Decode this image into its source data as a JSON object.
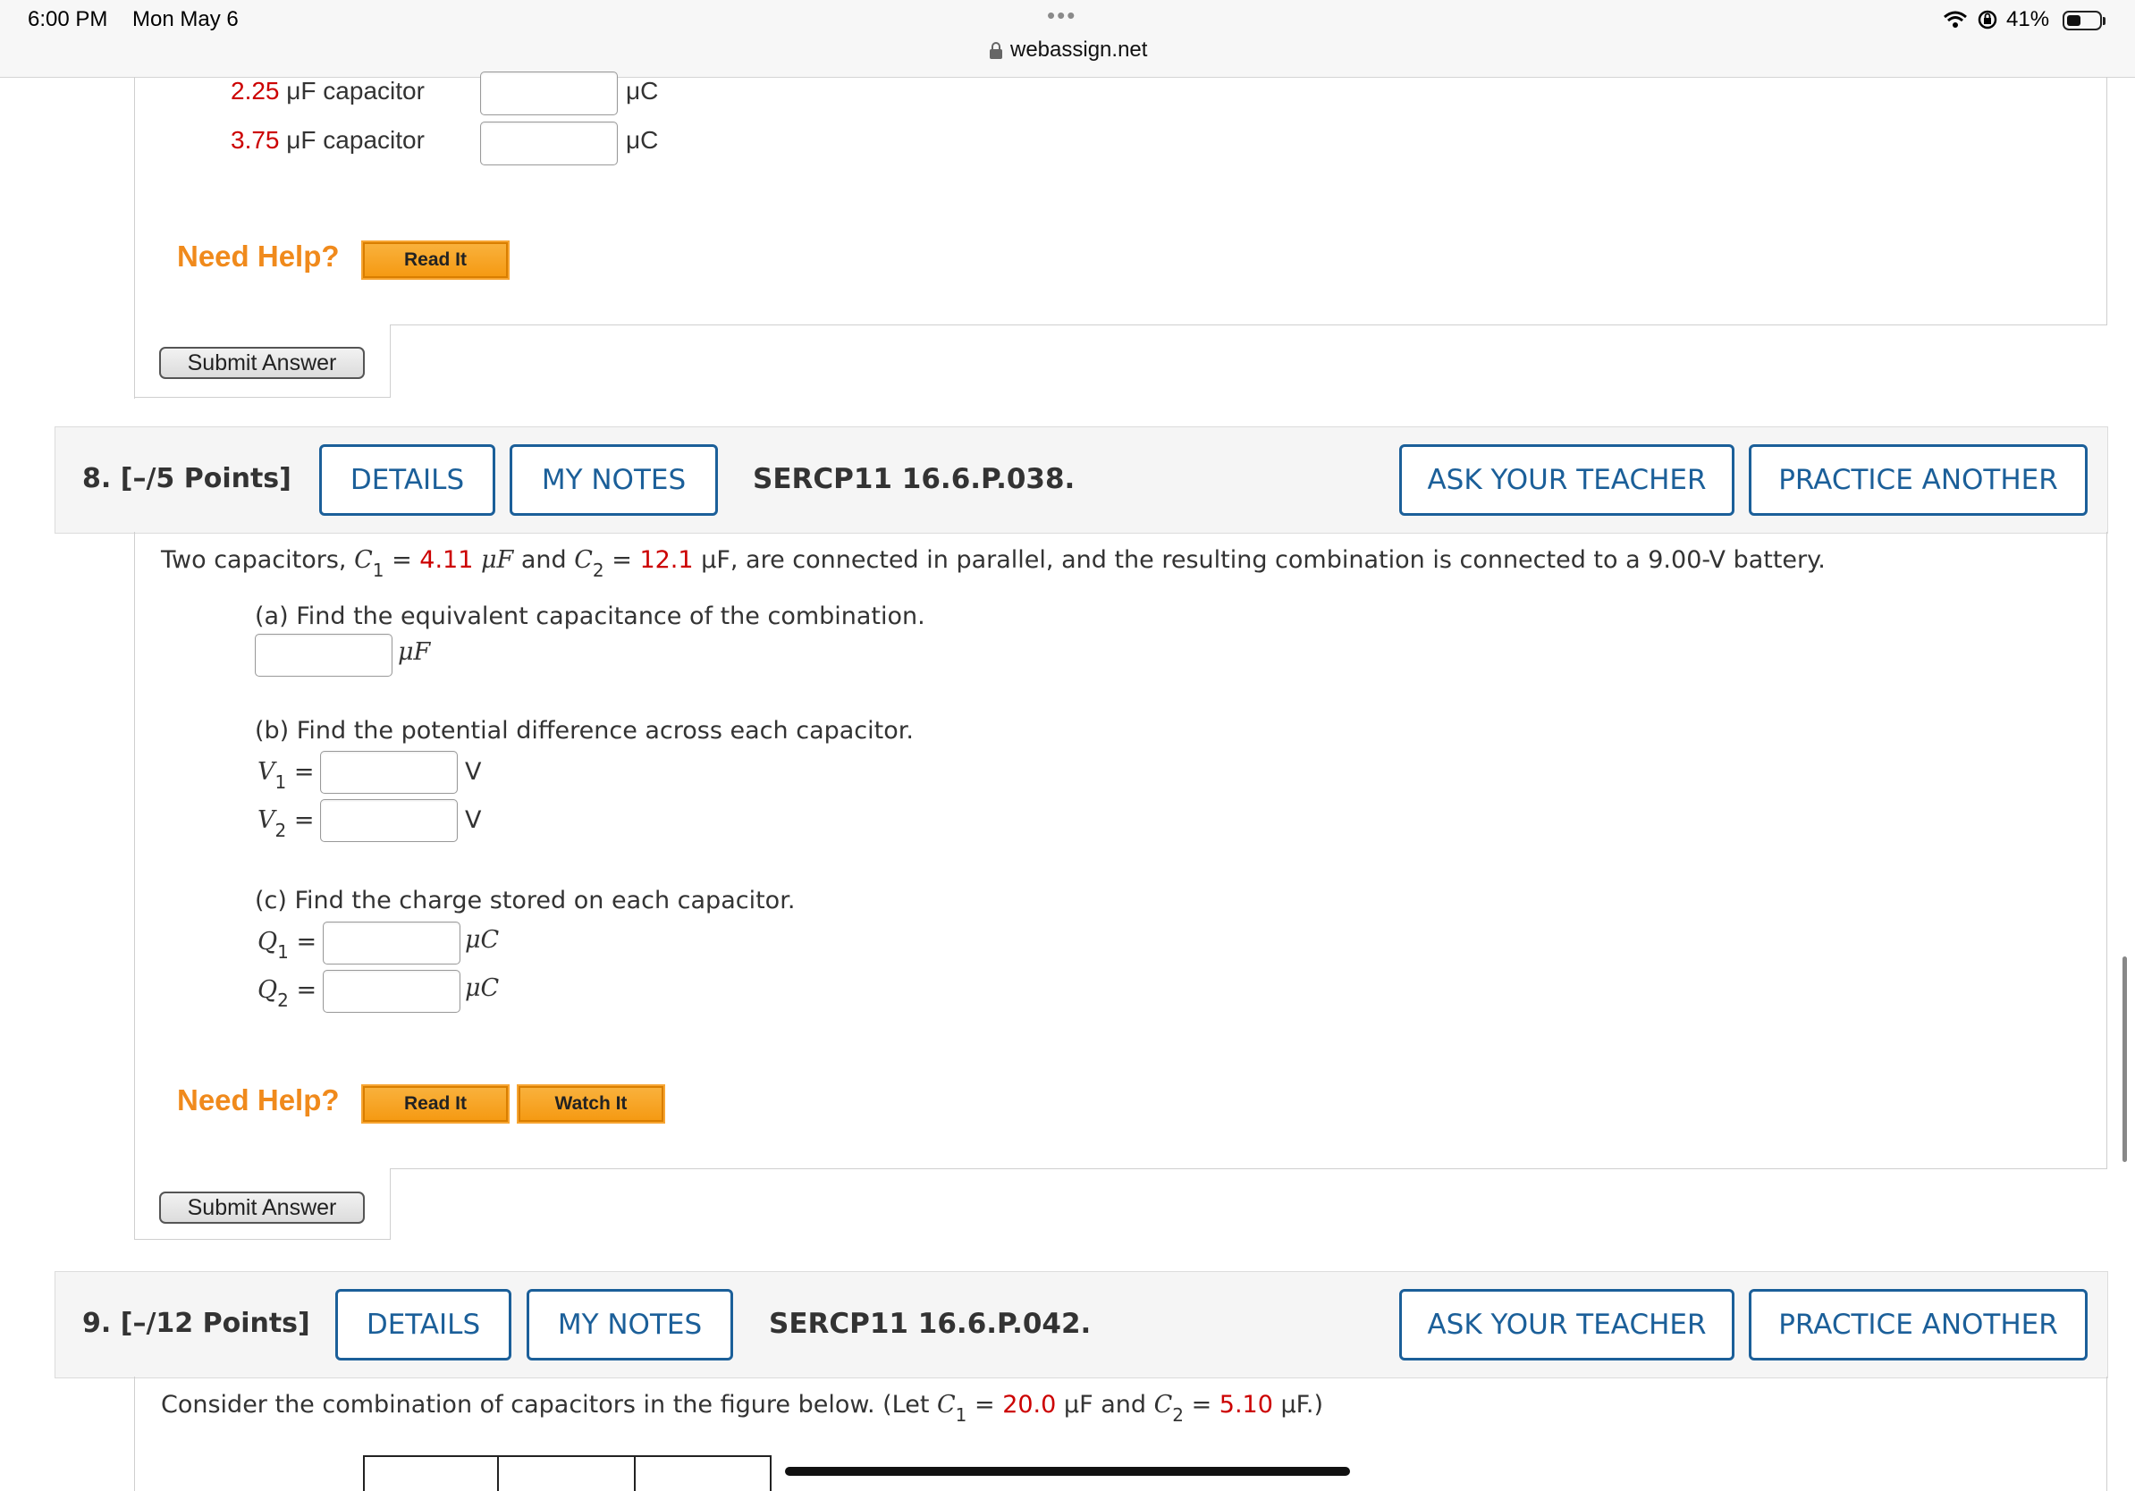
{
  "status_bar": {
    "time": "6:00 PM",
    "date": "Mon May 6",
    "dots": "•••",
    "url": "webassign.net",
    "battery": "41%",
    "battery_level": 0.41
  },
  "prev_question": {
    "rows": [
      {
        "value": "2.25",
        "label": " μF capacitor",
        "unit": "μC"
      },
      {
        "value": "3.75",
        "label": " μF capacitor",
        "unit": "μC"
      }
    ],
    "need_help": "Need Help?",
    "read_it": "Read It",
    "submit": "Submit Answer"
  },
  "q8": {
    "number": "8.",
    "points": "[–/5 Points]",
    "details": "DETAILS",
    "my_notes": "MY NOTES",
    "code": "SERCP11 16.6.P.038.",
    "ask_teacher": "ASK YOUR TEACHER",
    "practice": "PRACTICE ANOTHER",
    "text_1": "Two capacitors, ",
    "c1_sym": "C",
    "c1_sub": "1",
    "eq": " = ",
    "c1_val": "4.11",
    "uf": " μF",
    "and": " and ",
    "c2_sym": "C",
    "c2_sub": "2",
    "c2_val": "12.1",
    "text_2": "μF, are connected in parallel, and the resulting combination is connected to a 9.00-V battery.",
    "part_a": "(a) Find the equivalent capacitance of the combination.",
    "part_a_unit": "μF",
    "part_b": "(b) Find the potential difference across each capacitor.",
    "v1_sym": "V",
    "v1_sub": "1",
    "v2_sym": "V",
    "v2_sub": "2",
    "v_unit": "V",
    "equals": "=",
    "part_c": "(c) Find the charge stored on each capacitor.",
    "q1_sym": "Q",
    "q1_sub": "1",
    "q2_sym": "Q",
    "q2_sub": "2",
    "q_unit": "μC",
    "need_help": "Need Help?",
    "read_it": "Read It",
    "watch_it": "Watch It",
    "submit": "Submit Answer"
  },
  "q9": {
    "number": "9.",
    "points": "[–/12 Points]",
    "details": "DETAILS",
    "my_notes": "MY NOTES",
    "code": "SERCP11 16.6.P.042.",
    "ask_teacher": "ASK YOUR TEACHER",
    "practice": "PRACTICE ANOTHER",
    "text_1": "Consider the combination of capacitors in the figure below. (Let ",
    "c1_sym": "C",
    "c1_sub": "1",
    "eq": " = ",
    "c1_val": "20.0",
    "c1_unit": " μF and ",
    "c2_sym": "C",
    "c2_sub": "2",
    "c2_val": "5.10",
    "c2_unit": " μF.)"
  }
}
